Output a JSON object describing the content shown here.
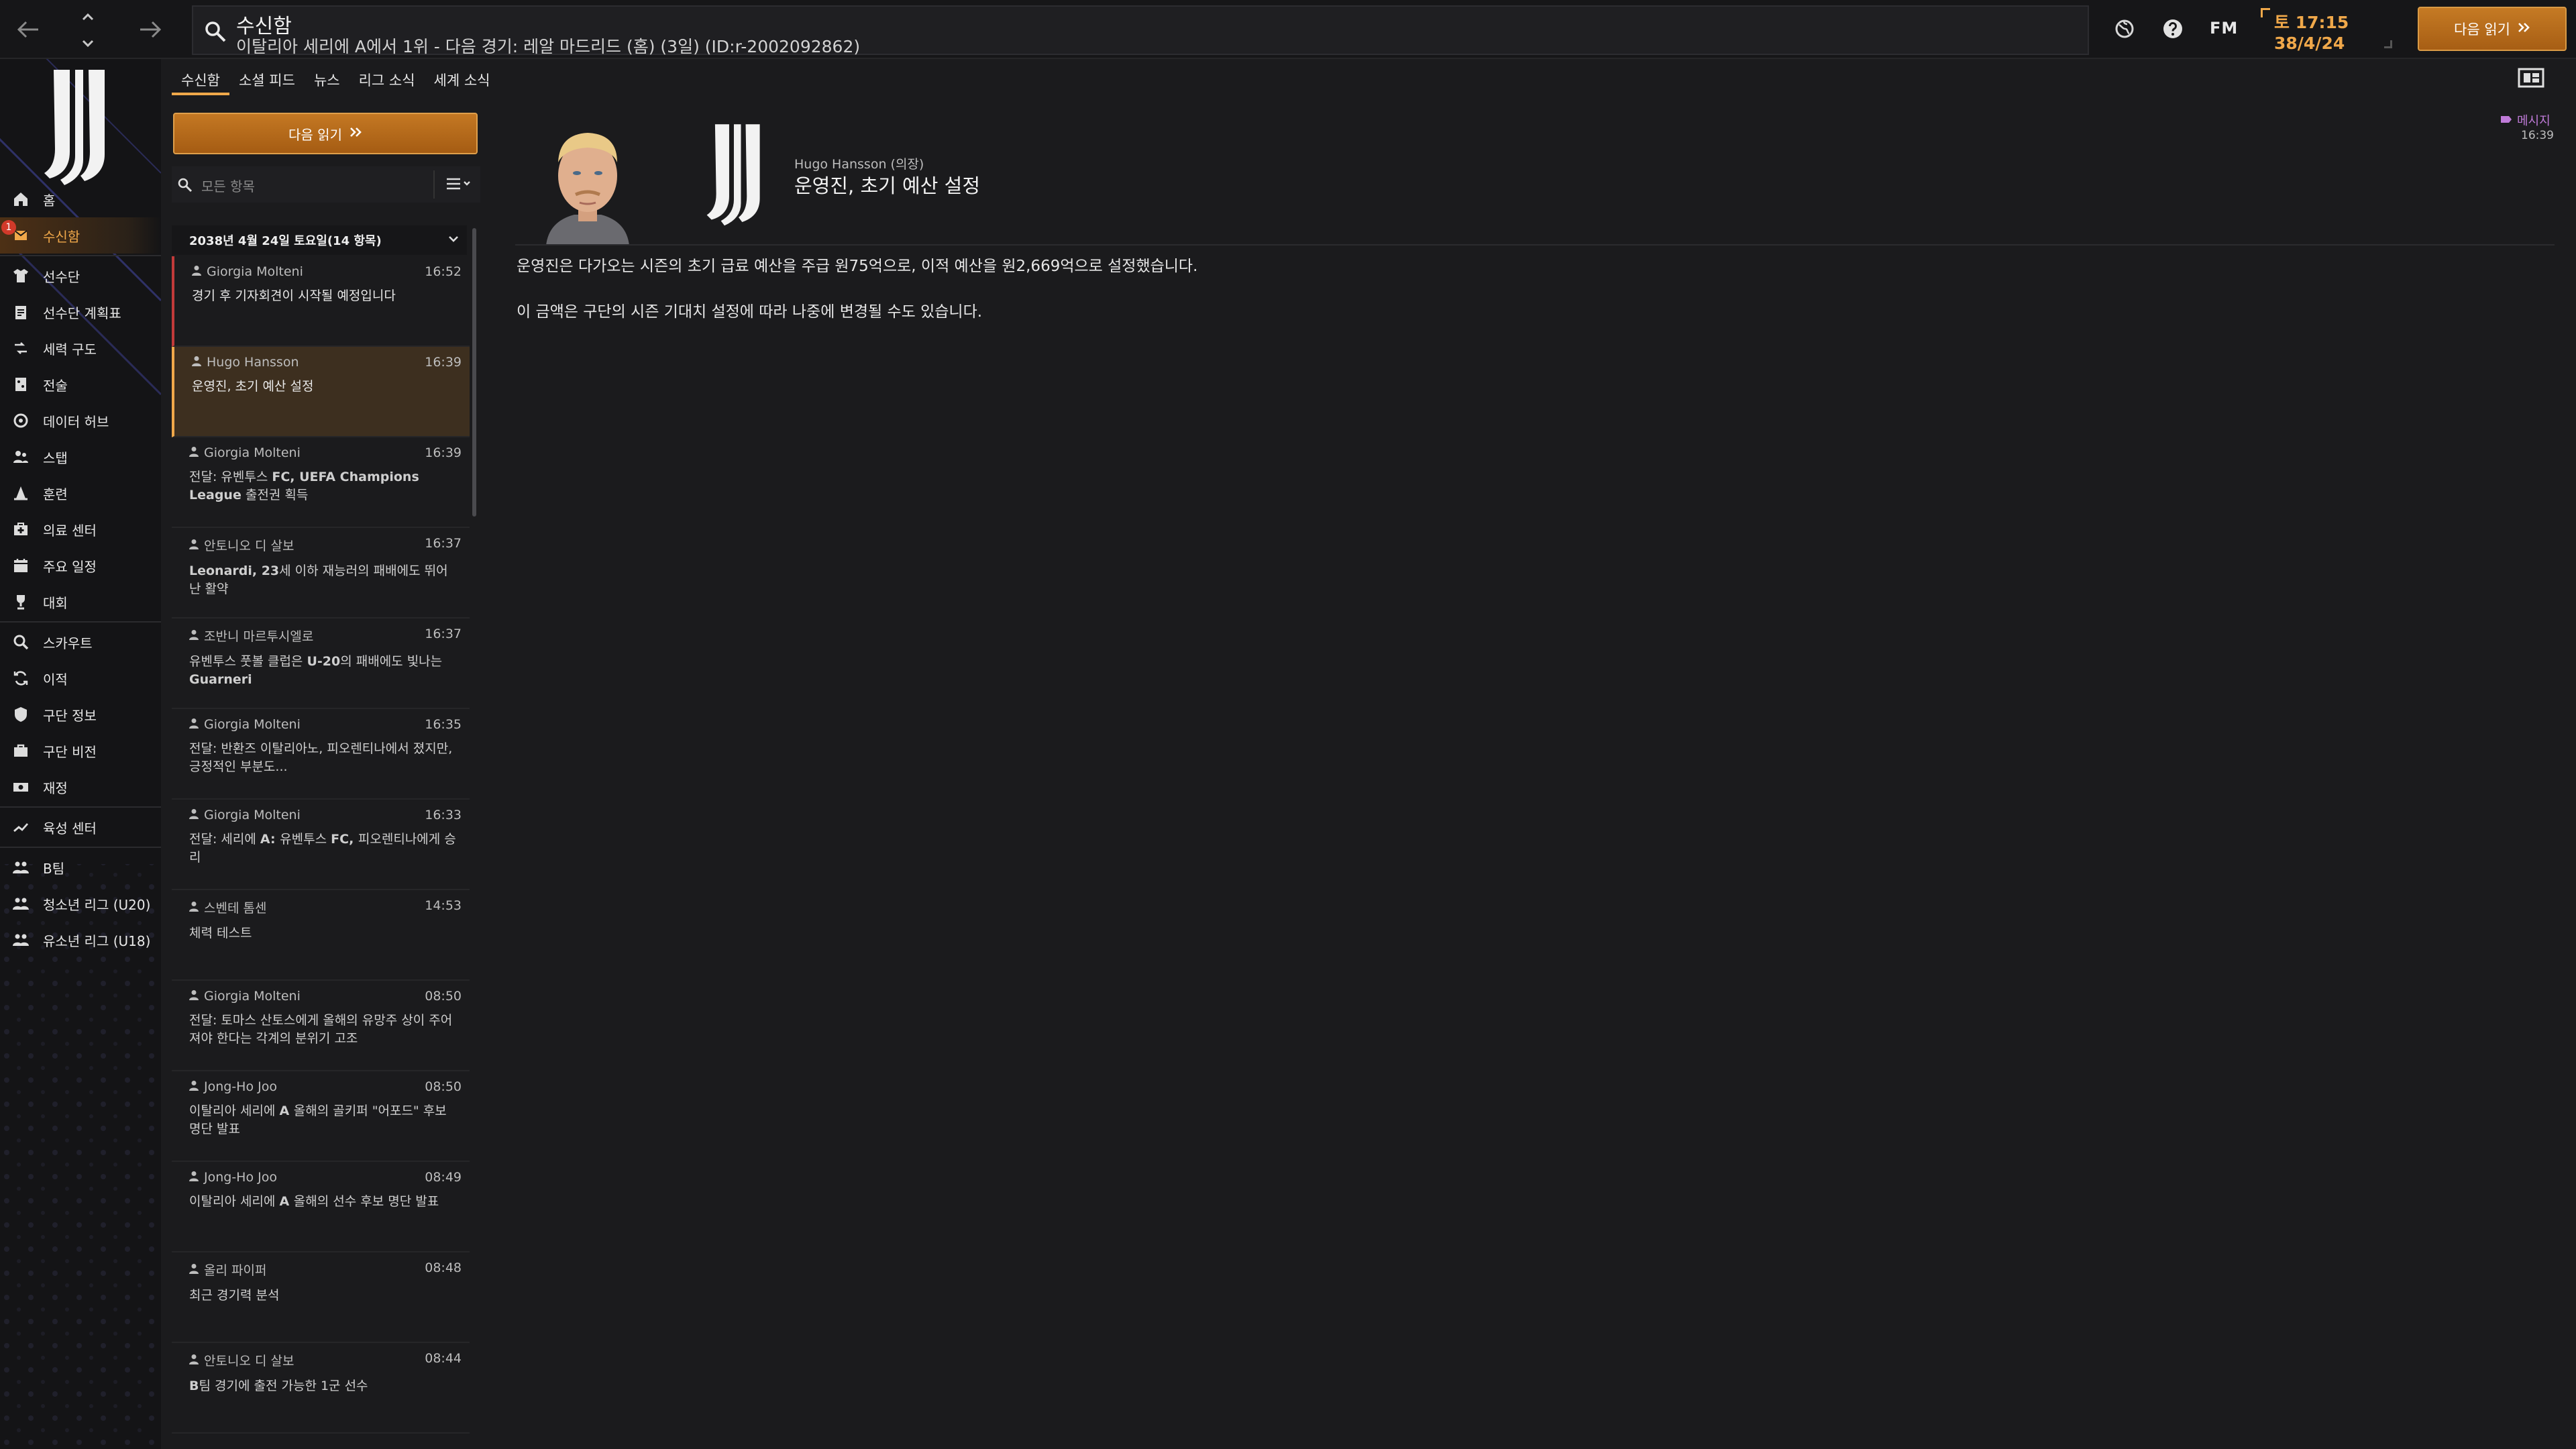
{
  "topbar": {
    "title": "수신함",
    "subtitle": "이탈리아 세리에 A에서 1위 - 다음 경기: 레알 마드리드 (홈) (3일) (ID:r-2002092862)",
    "fm_logo": "FM",
    "date_line1": "토 17:15",
    "date_line2": "38/4/24",
    "continue_label": "다음 읽기"
  },
  "sidebar": {
    "items": [
      {
        "label": "홈",
        "icon": "home-icon"
      },
      {
        "label": "수신함",
        "icon": "inbox-icon",
        "badge": "1",
        "active": true
      },
      {
        "label": "선수단",
        "icon": "shirt-icon"
      },
      {
        "label": "선수단 계획표",
        "icon": "clipboard-icon"
      },
      {
        "label": "세력 구도",
        "icon": "dynamics-icon"
      },
      {
        "label": "전술",
        "icon": "tactics-icon"
      },
      {
        "label": "데이터 허브",
        "icon": "data-hub-icon"
      },
      {
        "label": "스탭",
        "icon": "staff-icon"
      },
      {
        "label": "훈련",
        "icon": "training-cone-icon"
      },
      {
        "label": "의료 센터",
        "icon": "medical-icon"
      },
      {
        "label": "주요 일정",
        "icon": "calendar-icon"
      },
      {
        "label": "대회",
        "icon": "trophy-icon"
      },
      {
        "label": "스카우트",
        "icon": "scout-icon"
      },
      {
        "label": "이적",
        "icon": "transfer-icon"
      },
      {
        "label": "구단 정보",
        "icon": "shield-icon"
      },
      {
        "label": "구단 비전",
        "icon": "briefcase-icon"
      },
      {
        "label": "재정",
        "icon": "money-icon"
      },
      {
        "label": "육성 센터",
        "icon": "development-icon"
      },
      {
        "label": "B팀",
        "icon": "team-icon"
      },
      {
        "label": "청소년 리그 (U20)",
        "icon": "team-icon"
      },
      {
        "label": "유소년 리그 (U18)",
        "icon": "team-icon"
      }
    ]
  },
  "tabs": [
    "수신함",
    "소셜 피드",
    "뉴스",
    "리그 소식",
    "세계 소식"
  ],
  "inbox": {
    "continue_label": "다음 읽기",
    "filter_placeholder": "모든 항목",
    "group_header": "2038년 4월 24일 토요일(14 항목)",
    "messages": [
      {
        "sender": "Giorgia Molteni",
        "time": "16:52",
        "subject": "경기 후 기자회견이 시작될 예정입니다",
        "state": "unread-red"
      },
      {
        "sender": "Hugo Hansson",
        "time": "16:39",
        "subject": "운영진, 초기 예산 설정",
        "state": "selected"
      },
      {
        "sender": "Giorgia Molteni",
        "time": "16:39",
        "subject_plain": "전달: 유벤투스 ",
        "subject_bold": "FC, UEFA Champions League",
        "subject_tail": " 출전권 획득",
        "state": "read"
      },
      {
        "sender": "안토니오 디 살보",
        "time": "16:37",
        "subject_bold": "Leonardi, 23",
        "subject_plain_after": "세 이하 재능러의 패배에도 뛰어난 활약",
        "state": "read"
      },
      {
        "sender": "조반니 마르투시엘로",
        "time": "16:37",
        "subject_plain": "유벤투스 풋볼 클럽은 ",
        "subject_bold": "U-20",
        "subject_tail": "의 패배에도 빛나는 ",
        "subject_bold2": "Guarneri",
        "state": "read"
      },
      {
        "sender": "Giorgia Molteni",
        "time": "16:35",
        "subject": "전달: 반환즈 이탈리아노, 피오렌티나에서 졌지만, 긍정적인 부분도...",
        "state": "read"
      },
      {
        "sender": "Giorgia Molteni",
        "time": "16:33",
        "subject_plain": "전달: 세리에 ",
        "subject_bold": "A: ",
        "subject_tail": "유벤투스 ",
        "subject_bold2": "FC, ",
        "subject_tail2": "피오렌티나에게 승리",
        "state": "read"
      },
      {
        "sender": "스벤테 톰센",
        "time": "14:53",
        "subject": "체력 테스트",
        "state": "read"
      },
      {
        "sender": "Giorgia Molteni",
        "time": "08:50",
        "subject": "전달: 토마스 산토스에게 올해의 유망주 상이 주어져야 한다는 각계의 분위기 고조",
        "state": "read"
      },
      {
        "sender": "Jong-Ho Joo",
        "time": "08:50",
        "subject_plain": "이탈리아 세리에 ",
        "subject_bold": "A ",
        "subject_tail": "올해의 골키퍼 \"어포드\" 후보 명단 발표",
        "state": "read"
      },
      {
        "sender": "Jong-Ho Joo",
        "time": "08:49",
        "subject_plain": "이탈리아 세리에 ",
        "subject_bold": "A ",
        "subject_tail": "올해의 선수 후보 명단 발표",
        "state": "read"
      },
      {
        "sender": "올리 파이퍼",
        "time": "08:48",
        "subject": "최근 경기력 분석",
        "state": "read"
      },
      {
        "sender": "안토니오 디 살보",
        "time": "08:44",
        "subject_bold": "B",
        "subject_plain_after": "팀 경기에 출전 가능한 1군 선수",
        "state": "read"
      }
    ]
  },
  "detail": {
    "sender": "Hugo Hansson (의장)",
    "subject": "운영진, 초기 예산 설정",
    "tag": "메시지",
    "tag_time": "16:39",
    "body": [
      "운영진은 다가오는 시즌의 초기 급료 예산을 주급 원75억으로, 이적 예산을 원2,669억으로 설정했습니다.",
      "이 금액은 구단의 시즌 기대치 설정에 따라 나중에 변경될 수도 있습니다."
    ]
  },
  "colors": {
    "accent": "#f0a84a",
    "button_orange": "#b86a1c",
    "selected_row": "#3d2f1f",
    "unread_marker": "#c23a3a",
    "tag_purple": "#c07bd9"
  }
}
